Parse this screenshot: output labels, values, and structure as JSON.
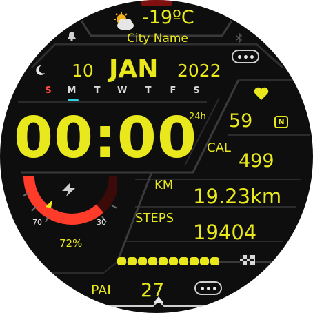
{
  "weather": {
    "temperature": "-19ºC",
    "city": "City Name",
    "icon": "sun-behind-cloud-icon"
  },
  "date": {
    "day": "10",
    "month": "JAN",
    "year": "2022"
  },
  "week": {
    "days": [
      "S",
      "M",
      "T",
      "W",
      "T",
      "F",
      "S"
    ],
    "active_index": 1
  },
  "time": {
    "value": "00:00",
    "format": "24h"
  },
  "heart": {
    "value": "59",
    "icon": "heart-icon",
    "badge": "N"
  },
  "calories": {
    "label": "CAL",
    "value": "499"
  },
  "distance": {
    "label": "KM",
    "value": "19.23km"
  },
  "steps": {
    "label": "STEPS",
    "value": "19404",
    "goal_progress": 1.0,
    "segments": 10
  },
  "battery": {
    "percent_label": "72%",
    "level": 0.72,
    "scale_low": "70",
    "scale_high": "30"
  },
  "pai": {
    "label": "PAI",
    "value": "27"
  },
  "colors": {
    "accent": "#e8e81c",
    "danger": "#ff3b2a",
    "background": "#0e0e0f",
    "sunday": "#ff4a3d",
    "selection": "#30d2e0"
  }
}
